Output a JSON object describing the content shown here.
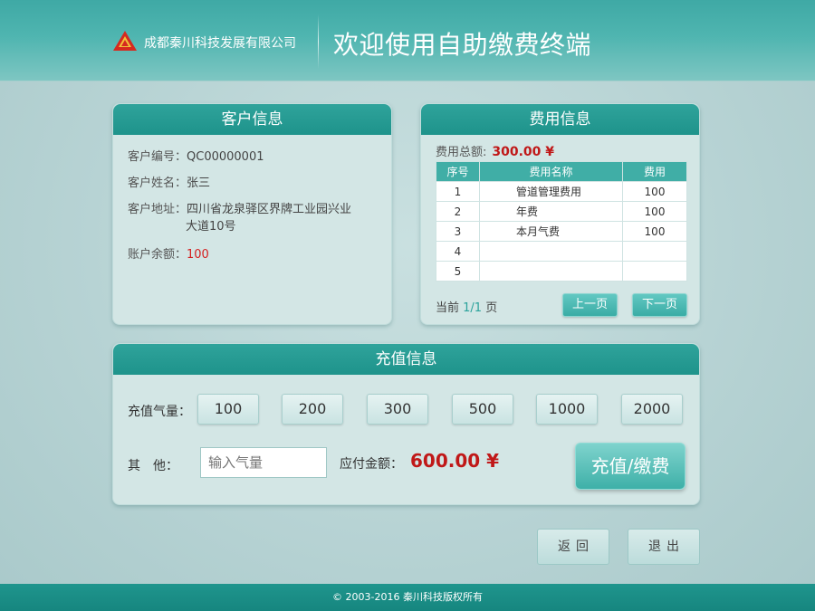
{
  "header": {
    "company": "成都秦川科技发展有限公司",
    "welcome": "欢迎使用自助缴费终端",
    "logo_icon": "company-logo"
  },
  "customer_panel": {
    "title": "客户信息",
    "id_label": "客户编号：",
    "id_value": "QC00000001",
    "name_label": "客户姓名：",
    "name_value": "张三",
    "address_label": "客户地址：",
    "address_line1": "四川省龙泉驿区界牌工业园兴业",
    "address_line2": "大道10号",
    "balance_label": "账户余额：",
    "balance_value": "100"
  },
  "fee_panel": {
    "title": "费用信息",
    "total_label": "费用总额:",
    "total_value": "300.00 ¥",
    "columns": [
      "序号",
      "费用名称",
      "费用"
    ],
    "rows": [
      [
        "1",
        "管道管理费用",
        "100"
      ],
      [
        "2",
        "年费",
        "100"
      ],
      [
        "3",
        "本月气费",
        "100"
      ],
      [
        "4",
        "",
        ""
      ],
      [
        "5",
        "",
        ""
      ]
    ],
    "pager_prefix": "当前 ",
    "pager_current": "1/1",
    "pager_suffix": " 页",
    "prev_label": "上一页",
    "next_label": "下一页"
  },
  "recharge_panel": {
    "title": "充值信息",
    "amount_label": "充值气量：",
    "amounts": [
      "100",
      "200",
      "300",
      "500",
      "1000",
      "2000"
    ],
    "other_label": "其　他：",
    "other_placeholder": "输入气量",
    "pay_label": "应付金额：",
    "pay_value": "600.00 ¥",
    "pay_button": "充值/缴费"
  },
  "footer_buttons": {
    "back": "返回",
    "exit": "退出"
  },
  "footer": {
    "copyright": "© 2003-2016 秦川科技版权所有"
  },
  "colors": {
    "accent": "#1e938b",
    "amount_red": "#c01818"
  }
}
